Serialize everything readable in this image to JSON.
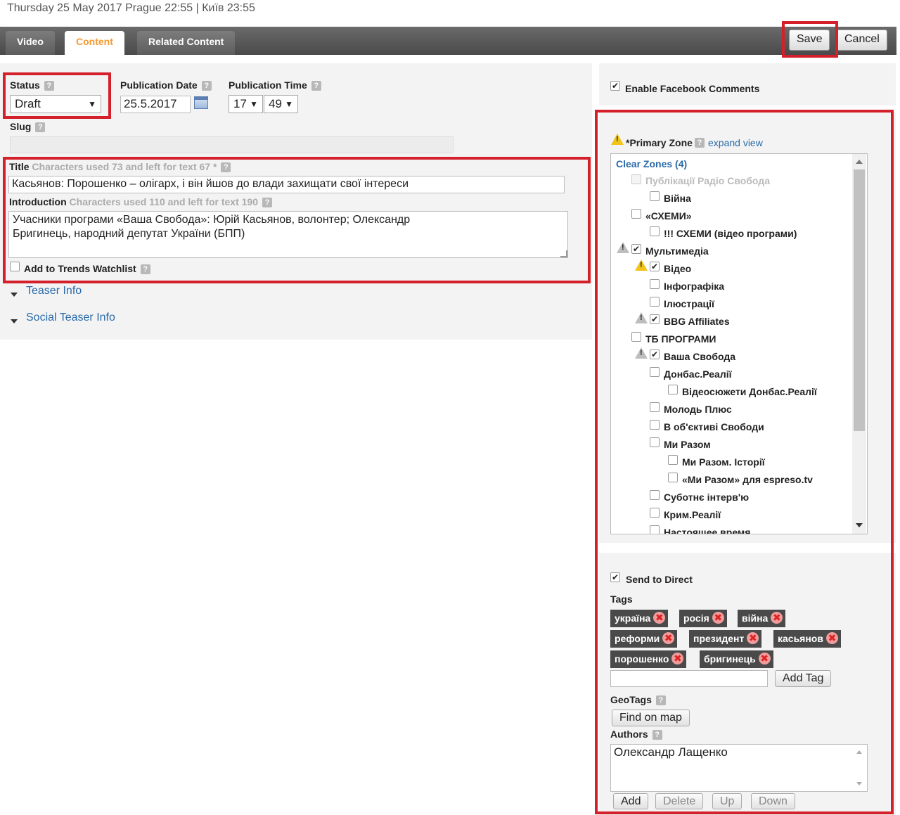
{
  "header": {
    "datetime": "Thursday 25 May 2017 Prague 22:55 | Київ 23:55",
    "tabs": [
      "Video",
      "Content",
      "Related Content"
    ],
    "active_tab": "Content",
    "save_label": "Save",
    "cancel_label": "Cancel"
  },
  "form": {
    "status_label": "Status",
    "status_value": "Draft",
    "pub_date_label": "Publication Date",
    "pub_date_value": "25.5.2017",
    "pub_time_label": "Publication Time",
    "pub_hour": "17",
    "pub_minute": "49",
    "slug_label": "Slug",
    "slug_value": "",
    "title_label": "Title",
    "title_counter": "Characters used 73 and left for text 67 *",
    "title_value": "Касьянов: Порошенко – олігарх, і він йшов до влади захищати свої інтереси",
    "intro_label": "Introduction",
    "intro_counter": "Characters used 110 and left for text 190",
    "intro_value": "Учасники програми «Ваша Свобода»: Юрій Касьянов, волонтер; Олександр Бригинець, народний депутат України (БПП)",
    "trends_label": "Add to Trends Watchlist",
    "teaser_link": "Teaser Info",
    "social_teaser_link": "Social Teaser Info"
  },
  "right": {
    "facebook_label": "Enable Facebook Comments",
    "primary_zone_label": "Primary Zone",
    "expand_view": "expand view",
    "clear_zones": "Clear Zones (4)",
    "zones": [
      {
        "label": "Публікації Радіо Свобода",
        "checked": false,
        "disabled": true
      },
      {
        "label": "Війна",
        "checked": false
      },
      {
        "label": "«СХЕМИ»",
        "checked": false
      },
      {
        "label": "!!! СХЕМИ (відео програми)",
        "checked": false
      },
      {
        "label": "Мультимедіа",
        "checked": true
      },
      {
        "label": "Відео",
        "checked": true
      },
      {
        "label": "Інфографіка",
        "checked": false
      },
      {
        "label": "Ілюстрації",
        "checked": false
      },
      {
        "label": "BBG Affiliates",
        "checked": true
      },
      {
        "label": "ТБ ПРОГРАМИ",
        "checked": false
      },
      {
        "label": "Ваша Свобода",
        "checked": true
      },
      {
        "label": "Донбас.Реалії",
        "checked": false
      },
      {
        "label": "Відеосюжети Донбас.Реалії",
        "checked": false
      },
      {
        "label": "Молодь Плюс",
        "checked": false
      },
      {
        "label": "В об'єктиві Свободи",
        "checked": false
      },
      {
        "label": "Ми Разом",
        "checked": false
      },
      {
        "label": "Ми Разом. Історії",
        "checked": false
      },
      {
        "label": "«Ми Разом» для espreso.tv",
        "checked": false
      },
      {
        "label": "Суботнє інтерв'ю",
        "checked": false
      },
      {
        "label": "Крим.Реалії",
        "checked": false
      },
      {
        "label": "Настоящее время",
        "checked": false
      }
    ],
    "send_direct_label": "Send to Direct",
    "tags_label": "Tags",
    "tags": [
      "україна",
      "росія",
      "війна",
      "реформи",
      "президент",
      "касьянов",
      "порошенко",
      "бригинець"
    ],
    "add_tag_label": "Add Tag",
    "geotags_label": "GeoTags",
    "find_on_map_label": "Find on map",
    "authors_label": "Authors",
    "authors": [
      "Олександр Лащенко"
    ],
    "author_buttons": [
      "Add",
      "Delete",
      "Up",
      "Down"
    ]
  },
  "icons": {
    "help": "help-icon",
    "calendar": "calendar-icon",
    "warning": "warning-icon",
    "remove_tag": "remove-tag-icon",
    "expand_arrow": "expand-arrow-icon"
  },
  "colors": {
    "highlight_box": "#d3202b",
    "active_tab_text": "#f39a30",
    "link": "#2a6aa8",
    "tag_bg": "#4a4a4a"
  }
}
